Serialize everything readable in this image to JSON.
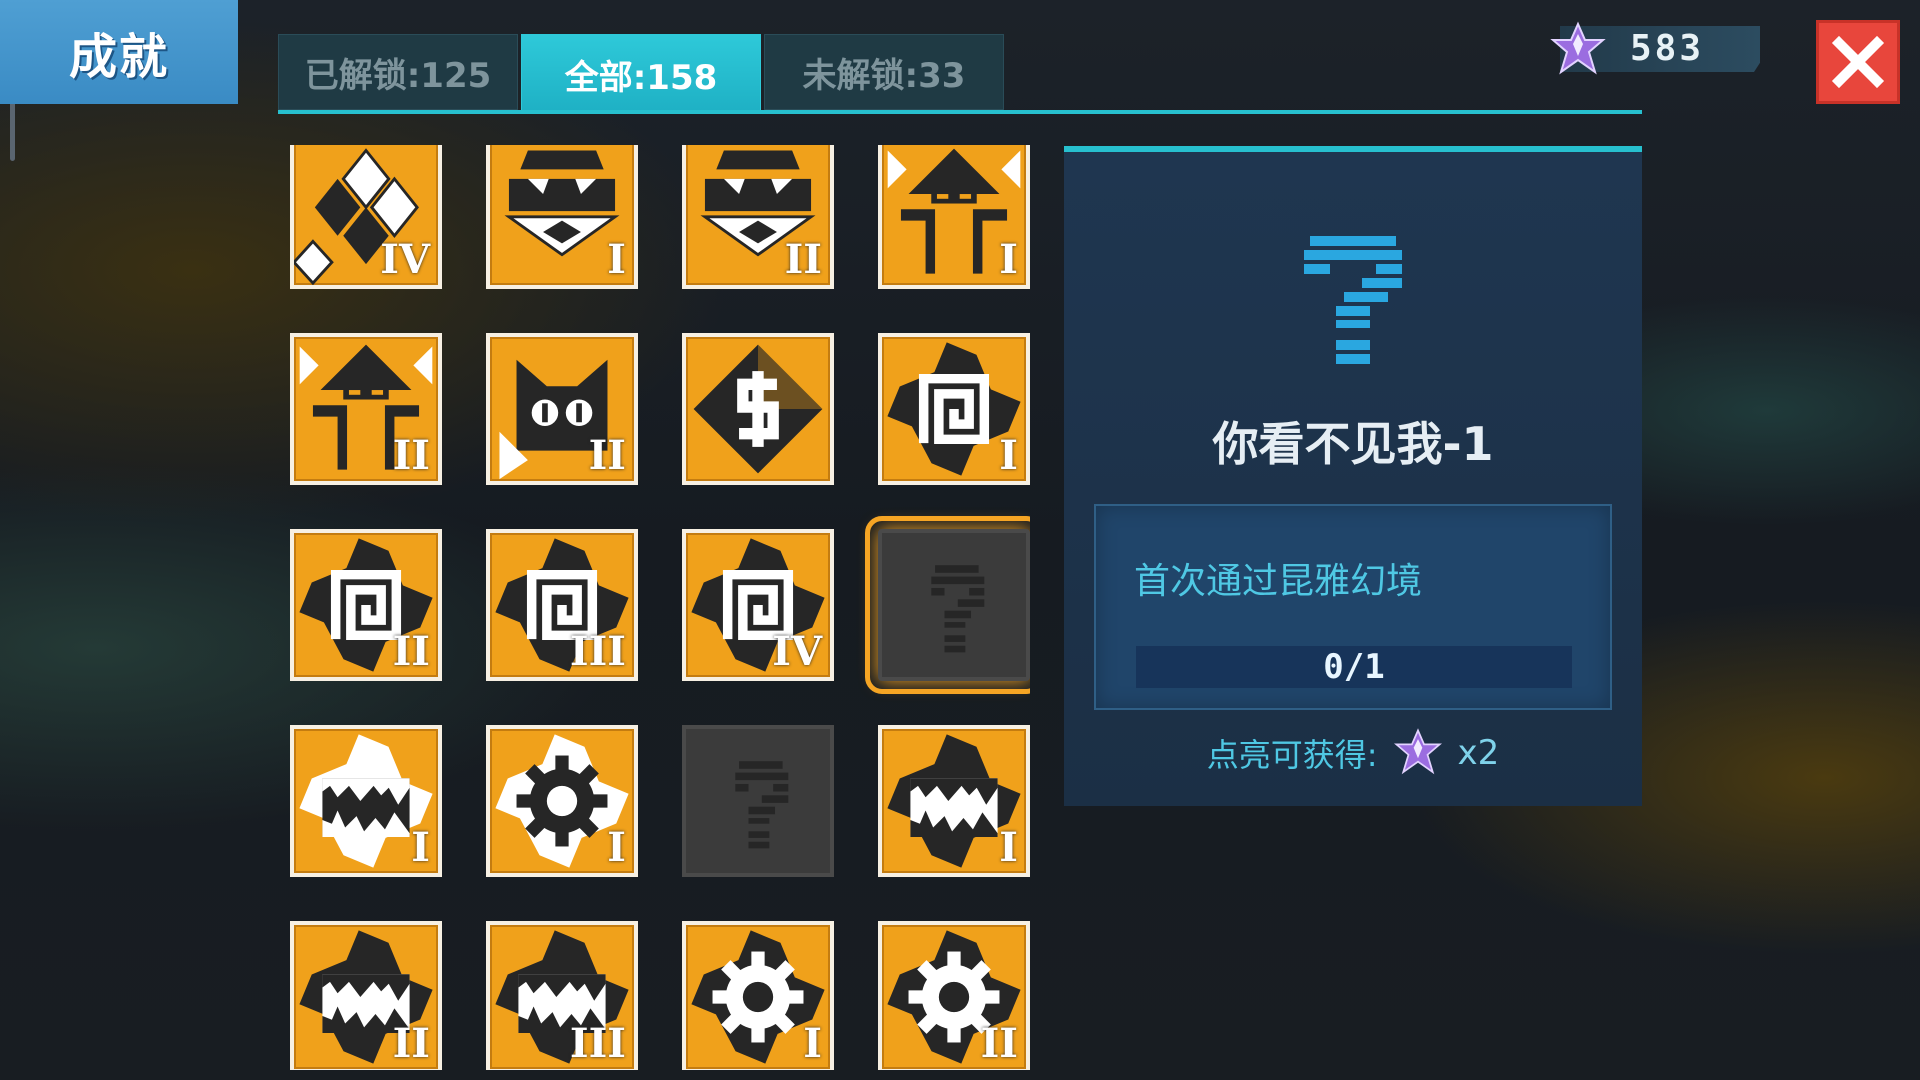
{
  "header": {
    "title": "成就"
  },
  "tabs": [
    {
      "label": "已解锁:125",
      "active": false
    },
    {
      "label": "全部:158",
      "active": true
    },
    {
      "label": "未解锁:33",
      "active": false
    }
  ],
  "currency": {
    "value": "583",
    "icon": "purple-star-gem-icon"
  },
  "close": {
    "icon": "close-icon"
  },
  "badges": [
    {
      "icon": "diamonds-icon",
      "tier": "IV",
      "locked": false
    },
    {
      "icon": "chest-face-icon",
      "tier": "I",
      "locked": false
    },
    {
      "icon": "chest-face-icon",
      "tier": "II",
      "locked": false
    },
    {
      "icon": "robot-head-icon",
      "tier": "I",
      "locked": false
    },
    {
      "icon": "robot-head-icon",
      "tier": "II",
      "locked": false
    },
    {
      "icon": "cat-face-icon",
      "tier": "II",
      "locked": false
    },
    {
      "icon": "dollar-icon",
      "tier": "",
      "locked": false
    },
    {
      "icon": "spiral-icon",
      "tier": "I",
      "locked": false
    },
    {
      "icon": "spiral-icon",
      "tier": "II",
      "locked": false
    },
    {
      "icon": "spiral-icon",
      "tier": "III",
      "locked": false
    },
    {
      "icon": "spiral-icon",
      "tier": "IV",
      "locked": false
    },
    {
      "icon": "question-mark-icon",
      "tier": "",
      "locked": true,
      "selected": true
    },
    {
      "icon": "cave-landscape-icon",
      "tier": "I",
      "locked": false,
      "variant": "light"
    },
    {
      "icon": "gear-icon",
      "tier": "I",
      "locked": false,
      "variant": "light"
    },
    {
      "icon": "question-mark-icon",
      "tier": "",
      "locked": true
    },
    {
      "icon": "cave-landscape-icon",
      "tier": "I",
      "locked": false
    },
    {
      "icon": "cave-landscape-icon",
      "tier": "II",
      "locked": false
    },
    {
      "icon": "cave-landscape-icon",
      "tier": "III",
      "locked": false
    },
    {
      "icon": "gear-icon",
      "tier": "I",
      "locked": false
    },
    {
      "icon": "gear-icon",
      "tier": "II",
      "locked": false
    }
  ],
  "detail": {
    "name": "你看不见我-1",
    "requirement": "首次通过昆雅幻境",
    "progress_text": "0/1",
    "progress_fraction": 0,
    "reward_label": "点亮可获得:",
    "reward_count": "x2",
    "reward_icon": "purple-star-gem-icon",
    "icon": "question-mark-icon"
  },
  "colors": {
    "accent": "#27c0cf",
    "badge": "#f0a11b",
    "close": "#e8463c",
    "title_bg": "#4f9fd3"
  }
}
